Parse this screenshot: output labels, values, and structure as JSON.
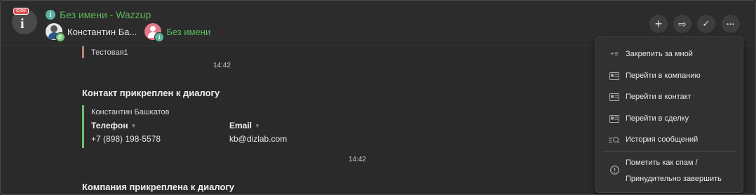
{
  "header": {
    "logo_badge": "CRM",
    "logo_letter": "i",
    "info_letter": "i",
    "title": "Без имени - Wazzup",
    "contact_name": "Константин Ба...",
    "second_contact_name": "Без имени",
    "buttons": {
      "add": "+",
      "forward": "⇨",
      "done": "✓",
      "more": "•••"
    }
  },
  "messages": {
    "quote_text": "Тестовая1",
    "time_1": "14:42",
    "contact_heading": "Контакт прикреплен к диалогу",
    "contact_card": {
      "name": "Константин Башкатов",
      "phone_label": "Телефон",
      "phone_value": "+7 (898) 198-5578",
      "email_label": "Email",
      "email_value": "kb@dizlab.com"
    },
    "time_2": "14:42",
    "company_heading": "Компания прикреплена к диалогу"
  },
  "menu": {
    "items": [
      {
        "label": "Закрепить за мной",
        "icon": "pin-list-icon"
      },
      {
        "label": "Перейти в компанию",
        "icon": "company-card-icon"
      },
      {
        "label": "Перейти в контакт",
        "icon": "contact-card-icon"
      },
      {
        "label": "Перейти в сделку",
        "icon": "deal-card-icon"
      },
      {
        "label": "История сообщений",
        "icon": "history-search-icon"
      }
    ],
    "spam_line_1": "Пометить как спам /",
    "spam_line_2": "Принудительно завершить",
    "spam_icon": "alert-circle-icon"
  },
  "colors": {
    "accent_green": "#5cb85c",
    "background": "#2a2a2a",
    "contact_bar": "#6cc070",
    "quote_bar": "#b8866b"
  }
}
